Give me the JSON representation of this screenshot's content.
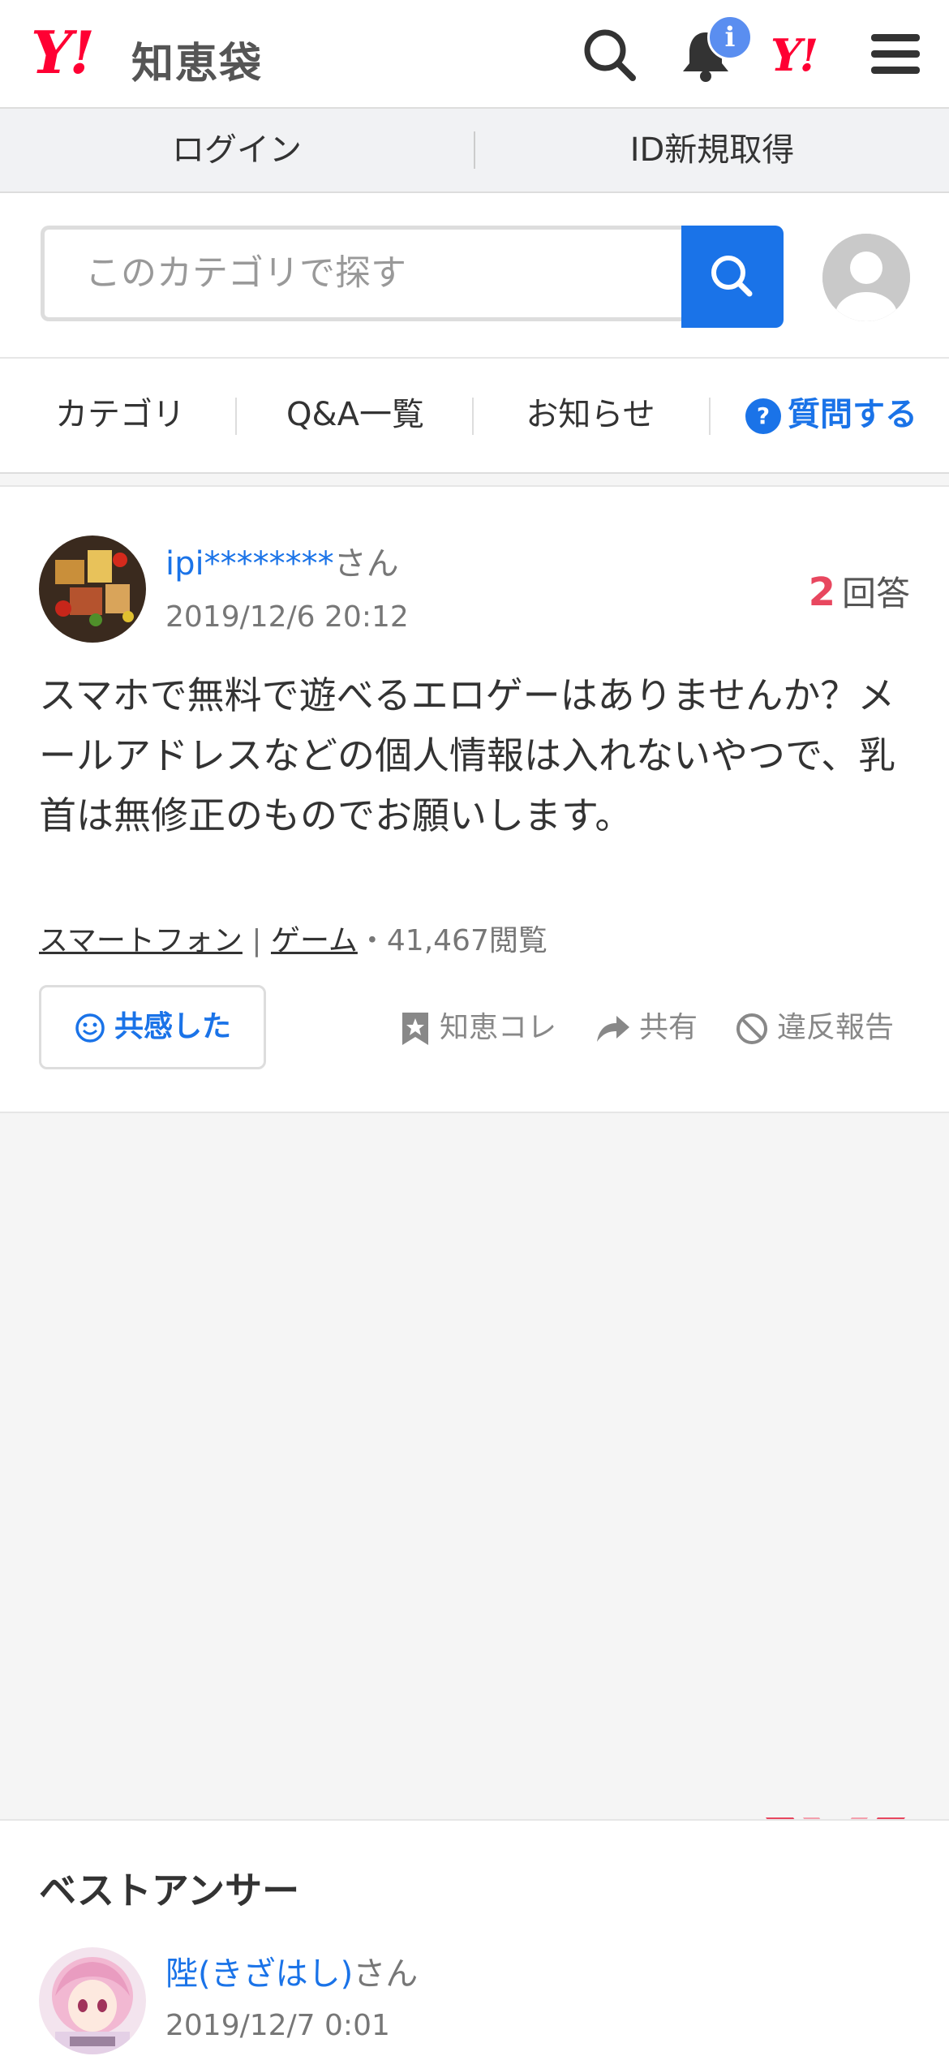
{
  "header": {
    "logo_mark": "Y!",
    "logo_text": "知恵袋",
    "notification_badge": "i",
    "yahoo_mark": "Y!"
  },
  "auth": {
    "login": "ログイン",
    "register": "ID新規取得"
  },
  "search": {
    "placeholder": "このカテゴリで探す"
  },
  "tabs": {
    "category": "カテゴリ",
    "qa_list": "Q&A一覧",
    "news": "お知らせ",
    "ask": "質問する"
  },
  "question": {
    "user_name": "ipi********",
    "user_suffix": "さん",
    "date": "2019/12/6 20:12",
    "answer_count": "2",
    "answer_label": "回答",
    "body": "スマホで無料で遊べるエロゲーはありませんか？メールアドレスなどの個人情報は入れないやつで、乳首は無修正のものでお願いします。",
    "category_1": "スマートフォン",
    "separator": "|",
    "category_2": "ゲーム",
    "views": "・41,467閲覧",
    "empathy_label": "共感した",
    "save_label": "知恵コレ",
    "share_label": "共有",
    "report_label": "違反報告"
  },
  "best_answer": {
    "title": "ベストアンサー",
    "user_name": "陛(きざはし)",
    "user_suffix": "さん",
    "date": "2019/12/7 0:01"
  },
  "colors": {
    "brand_red": "#ff0033",
    "link_blue": "#1a73e8",
    "answer_count_red": "#e8475f",
    "medal_gold": "#f7c948"
  }
}
